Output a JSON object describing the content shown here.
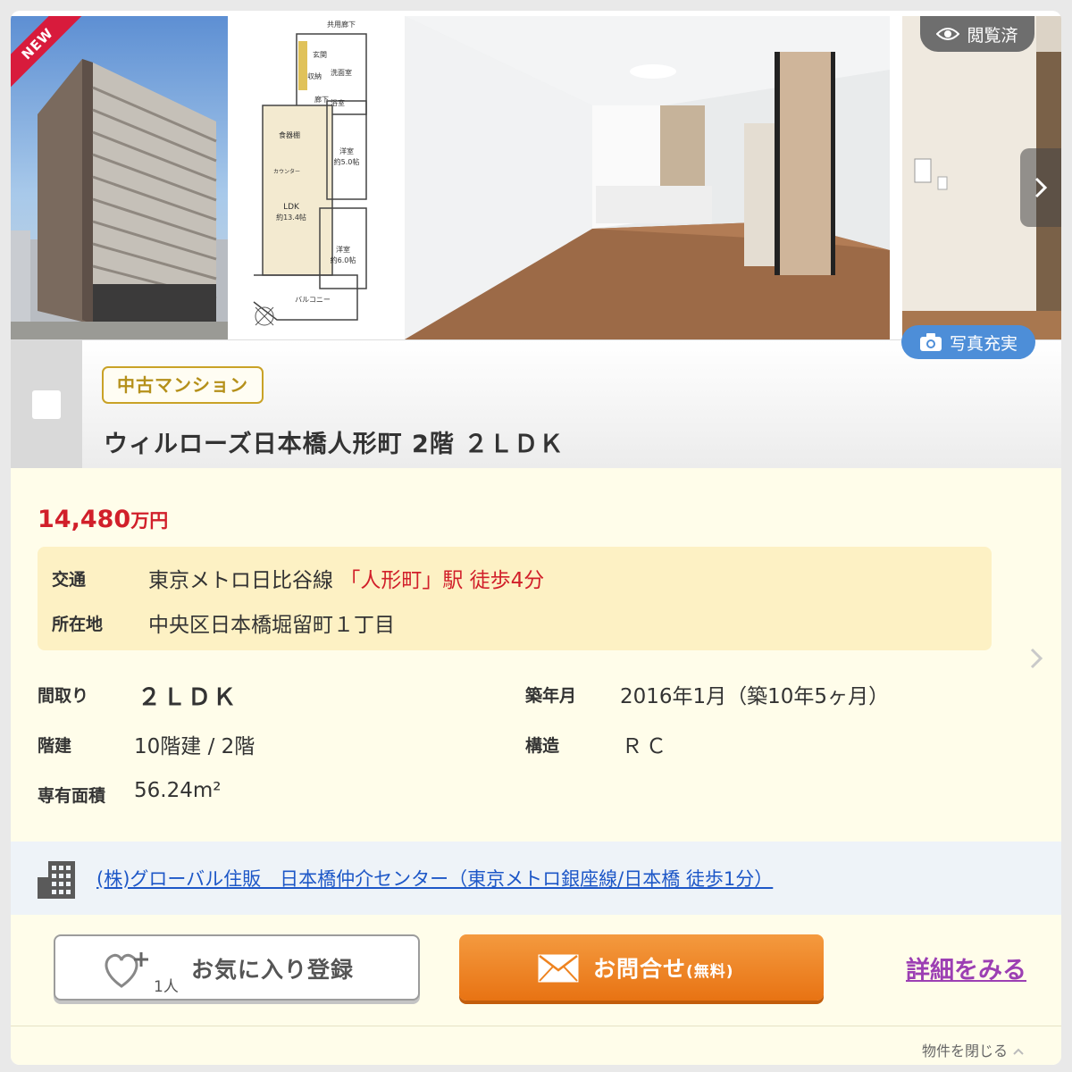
{
  "badges": {
    "new": "NEW",
    "viewed": "閲覧済",
    "photo_rich": "写真充実"
  },
  "property": {
    "type": "中古マンション",
    "title": "ウィルローズ日本橋人形町 2階 ２ＬＤＫ",
    "price_value": "14,480",
    "price_unit": "万円",
    "access": {
      "label": "交通",
      "line": "東京メトロ日比谷線",
      "station": "「人形町」駅 徒歩4分"
    },
    "address": {
      "label": "所在地",
      "value": "中央区日本橋堀留町１丁目"
    },
    "specs": {
      "layout_label": "間取り",
      "layout_value": "２ＬＤＫ",
      "built_label": "築年月",
      "built_value": "2016年1月（築10年5ヶ月）",
      "floors_label": "階建",
      "floors_value": "10階建 / 2階",
      "structure_label": "構造",
      "structure_value": "ＲＣ",
      "area_label": "専有面積",
      "area_value": "56.24m²"
    }
  },
  "floorplan": {
    "corridor": "共用廊下",
    "entrance": "玄関",
    "storage": "収納",
    "laundry": "洗面室",
    "hall": "廊下",
    "bath": "浴室",
    "pantry": "食器棚",
    "counter": "カウンター",
    "ldk": "LDK",
    "ldk_size": "約13.4帖",
    "west_room": "洋室",
    "west_room_size": "約5.0帖",
    "second_room": "洋室",
    "second_room_size": "約6.0帖",
    "balcony": "バルコニー"
  },
  "agent": {
    "link_text": "(株)グローバル住販　日本橋仲介センター（東京メトロ銀座線/日本橋 徒歩1分）"
  },
  "actions": {
    "favorite_label": "お気に入り登録",
    "favorite_count": "1人",
    "inquiry_label": "お問合せ",
    "inquiry_sub": "(無料)",
    "detail_label": "詳細をみる",
    "close_label": "物件を閉じる"
  },
  "icons": {
    "viewed": "eye-icon",
    "photo": "camera-icon",
    "next": "chevron-right-icon",
    "building": "building-icon",
    "favorite": "heart-plus-icon",
    "inquiry": "mail-icon",
    "close": "chevron-up-icon"
  },
  "colors": {
    "price_red": "#d11f2a",
    "badge_gold": "#c9a227",
    "inquiry_orange": "#ee8320",
    "link_blue": "#1d57c7",
    "detail_purple": "#9c3fb3",
    "details_bg": "#fffdea",
    "access_bg": "#fdf1c4"
  }
}
